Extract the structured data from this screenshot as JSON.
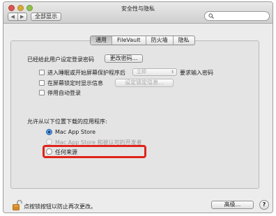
{
  "window": {
    "title": "安全性与隐私"
  },
  "toolbar": {
    "back_glyph": "◀",
    "forward_glyph": "▶",
    "show_all": "全部显示",
    "search_placeholder": ""
  },
  "tabs": [
    {
      "label": "通用",
      "active": true
    },
    {
      "label": "FileVault",
      "active": false
    },
    {
      "label": "防火墙",
      "active": false
    },
    {
      "label": "隐私",
      "active": false
    }
  ],
  "general": {
    "password_set_label": "已经给此用户设定登录密码",
    "change_password_button": "更改密码...",
    "require_password": {
      "label": "进入睡眠或开始屏幕保护程序后",
      "checked": false,
      "select_value": "立即",
      "suffix": "要求输入密码"
    },
    "lock_message": {
      "label": "在屏幕锁定时显示信息",
      "checked": false,
      "button": "设定锁定信息..."
    },
    "disable_autologin": {
      "label": "停用自动登录",
      "checked": false
    }
  },
  "gatekeeper": {
    "heading": "允许从以下位置下载的应用程序:",
    "options": [
      {
        "label": "Mac App Store",
        "selected": true,
        "disabled": false
      },
      {
        "label": "Mac App Store 和被认可的开发者",
        "selected": false,
        "disabled": true
      },
      {
        "label": "任何来源",
        "selected": false,
        "disabled": false
      }
    ]
  },
  "footer": {
    "lock_text": "点按锁按钮以防止再次更改。",
    "advanced_button": "高级...",
    "help_label": "?"
  },
  "colors": {
    "highlight": "#e0231c",
    "lock_icon": "#d98a1f"
  },
  "icons": [
    "search-icon",
    "lock-icon",
    "help-icon",
    "chevron-left-icon",
    "chevron-right-icon"
  ]
}
